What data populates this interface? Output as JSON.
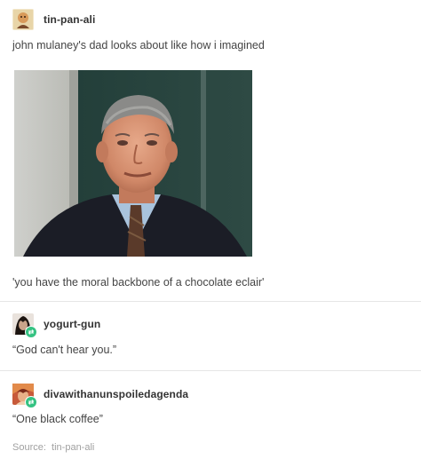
{
  "posts": [
    {
      "username": "tin-pan-ali",
      "text": "john mulaney's dad looks about like how i imagined",
      "caption": "'you have the moral backbone of a chocolate eclair'"
    },
    {
      "username": "yogurt-gun",
      "text": "“God can't hear you.”"
    },
    {
      "username": "divawithanunspoiledagenda",
      "text": "“One black coffee”"
    }
  ],
  "source": {
    "label": "Source:",
    "name": "tin-pan-ali"
  },
  "colors": {
    "text": "#444444",
    "username": "#333333",
    "divider": "#e6e6e6",
    "source": "#a0a0a0",
    "badge": "#35c282"
  },
  "icons": {
    "reblog_badge": "reblog-icon"
  }
}
